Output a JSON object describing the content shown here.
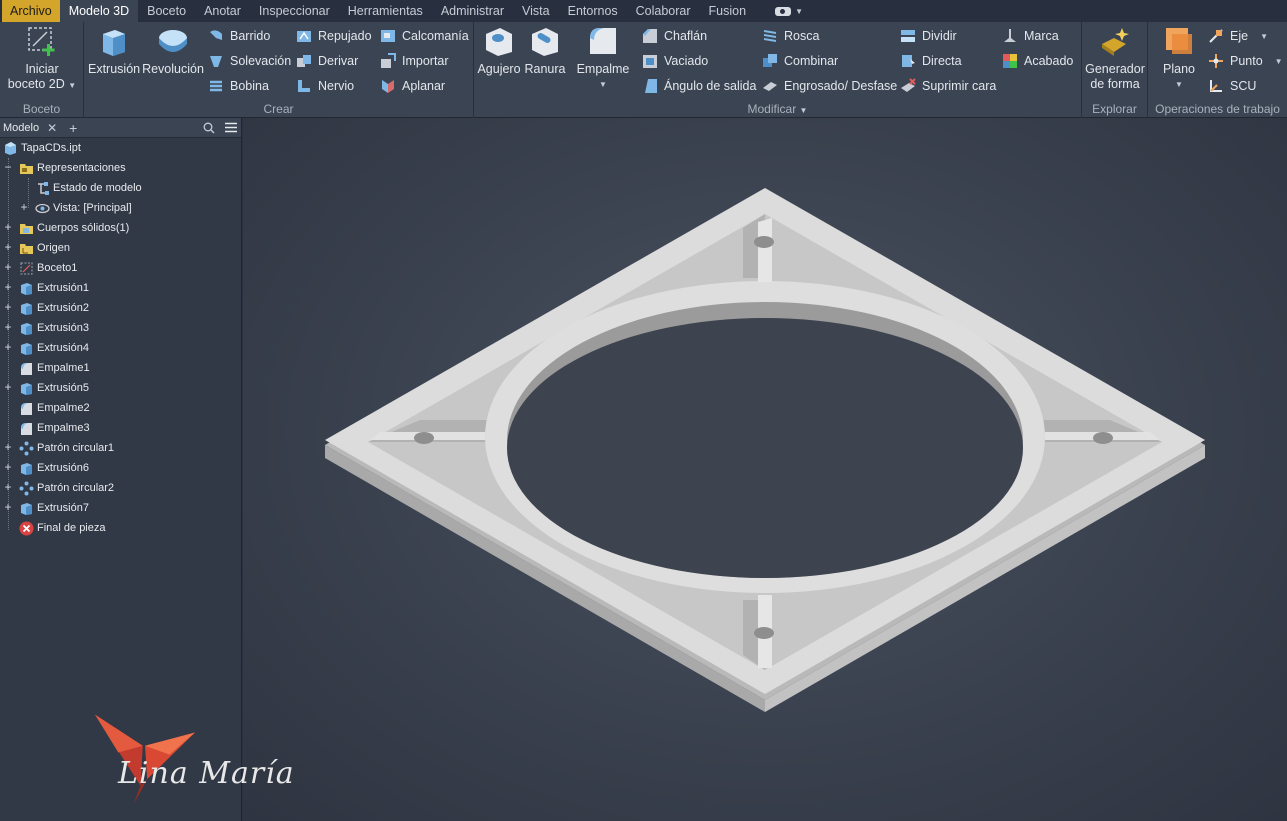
{
  "tabs": [
    "Archivo",
    "Modelo 3D",
    "Boceto",
    "Anotar",
    "Inspeccionar",
    "Herramientas",
    "Administrar",
    "Vista",
    "Entornos",
    "Colaborar",
    "Fusion"
  ],
  "active_tab": "Modelo 3D",
  "ribbon": {
    "boceto": {
      "title": "Boceto",
      "start_sketch": [
        "Iniciar",
        "boceto 2D"
      ]
    },
    "crear": {
      "title": "Crear",
      "extrusion": "Extrusión",
      "revolucion": "Revolución",
      "barrido": "Barrido",
      "solevacion": "Solevación",
      "bobina": "Bobina",
      "repujado": "Repujado",
      "derivar": "Derivar",
      "nervio": "Nervio",
      "calcomania": "Calcomanía",
      "importar": "Importar",
      "aplanar": "Aplanar"
    },
    "modificar": {
      "title": "Modificar",
      "agujero": "Agujero",
      "ranura": "Ranura",
      "empalme": "Empalme",
      "chaflan": "Chaflán",
      "vaciado": "Vaciado",
      "angulo": "Ángulo de salida",
      "rosca": "Rosca",
      "combinar": "Combinar",
      "engrosado": "Engrosado/ Desfase",
      "dividir": "Dividir",
      "directa": "Directa",
      "suprimir": "Suprimir cara",
      "marca": "Marca",
      "acabado": "Acabado"
    },
    "explorar": {
      "title": "Explorar",
      "generador": [
        "Generador",
        "de forma"
      ]
    },
    "operaciones": {
      "title": "Operaciones de trabajo",
      "plano": "Plano",
      "eje": "Eje",
      "punto": "Punto",
      "scu": "SCU"
    }
  },
  "browser": {
    "tab_label": "Modelo",
    "items": [
      {
        "label": "TapaCDs.ipt",
        "icon": "part-icon"
      },
      {
        "label": "Representaciones",
        "icon": "folder-icon"
      },
      {
        "label": "Estado de modelo",
        "icon": "model-state-icon"
      },
      {
        "label": "Vista: [Principal]",
        "icon": "view-icon"
      },
      {
        "label": "Cuerpos sólidos(1)",
        "icon": "folder-icon"
      },
      {
        "label": "Origen",
        "icon": "folder-icon"
      },
      {
        "label": "Boceto1",
        "icon": "sketch-icon"
      },
      {
        "label": "Extrusión1",
        "icon": "extrude-icon"
      },
      {
        "label": "Extrusión2",
        "icon": "extrude-icon"
      },
      {
        "label": "Extrusión3",
        "icon": "extrude-icon"
      },
      {
        "label": "Extrusión4",
        "icon": "extrude-icon"
      },
      {
        "label": "Empalme1",
        "icon": "fillet-icon"
      },
      {
        "label": "Extrusión5",
        "icon": "extrude-icon"
      },
      {
        "label": "Empalme2",
        "icon": "fillet-icon"
      },
      {
        "label": "Empalme3",
        "icon": "fillet-icon"
      },
      {
        "label": "Patrón circular1",
        "icon": "pattern-icon"
      },
      {
        "label": "Extrusión6",
        "icon": "extrude-icon"
      },
      {
        "label": "Patrón circular2",
        "icon": "pattern-icon"
      },
      {
        "label": "Extrusión7",
        "icon": "extrude-icon"
      },
      {
        "label": "Final de pieza",
        "icon": "end-of-part-icon"
      }
    ]
  },
  "watermark": "Lina María",
  "colors": {
    "file_tab": "#d3a52b",
    "ribbon_bg": "#3b4453",
    "viewport_bg": "#3a414e",
    "part": "#d4d4d4"
  }
}
